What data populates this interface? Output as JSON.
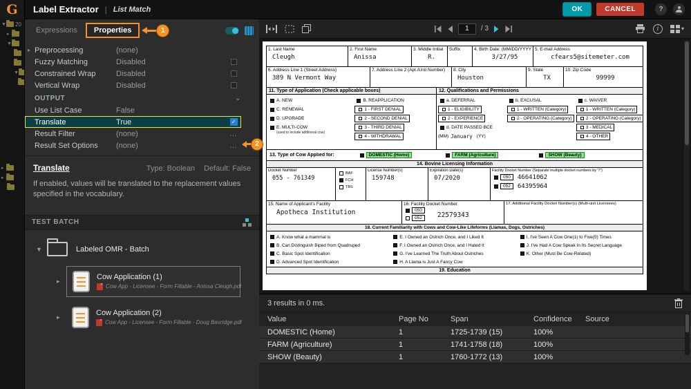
{
  "titlebar": {
    "logo": "G",
    "title": "Label Extractor",
    "separator": "|",
    "subtitle": "List Match",
    "ok_label": "OK",
    "cancel_label": "CANCEL"
  },
  "tree_strip": {
    "root_label": "20"
  },
  "panel": {
    "tabs": {
      "expressions": "Expressions",
      "properties": "Properties"
    },
    "callout1": "1",
    "callout2": "2",
    "rows": [
      {
        "label": "Preprocessing",
        "value": "(none)"
      },
      {
        "label": "Fuzzy Matching",
        "value": "Disabled"
      },
      {
        "label": "Constrained Wrap",
        "value": "Disabled"
      },
      {
        "label": "Vertical Wrap",
        "value": "Disabled"
      }
    ],
    "output_header": "OUTPUT",
    "output_rows": [
      {
        "label": "Use List Case",
        "value": "False"
      },
      {
        "label": "Translate",
        "value": "True"
      },
      {
        "label": "Result Filter",
        "value": "(none)"
      },
      {
        "label": "Result Set Options",
        "value": "(none)"
      }
    ],
    "help": {
      "title": "Translate",
      "type_text": "Type: Boolean",
      "default_text": "Default: False",
      "description": "If enabled, values will be translated to the replacement values specified in the vocabulary."
    },
    "test_batch": {
      "header": "TEST BATCH",
      "folder_label": "Labeled OMR - Batch",
      "docs": [
        {
          "title": "Cow Application (1)",
          "subtitle": "Cow App - Licensee - Form Fillable - Anissa Cleugh.pdf"
        },
        {
          "title": "Cow Application (2)",
          "subtitle": "Cow App - Licensee - Form Fillable - Doug Bavridge.pdf"
        }
      ]
    }
  },
  "viewer": {
    "page_number": "1",
    "page_total": "/ 3"
  },
  "form": {
    "row1": [
      {
        "label": "1. Last Name",
        "value": "Cleugh"
      },
      {
        "label": "2. First Name",
        "value": "Anissa"
      },
      {
        "label": "3. Middle Initial",
        "value": "R."
      },
      {
        "label": "Suffix",
        "value": ""
      },
      {
        "label": "4. Birth Date: (MM/DD/YYYY)",
        "value": "3/27/95"
      },
      {
        "label": "5. E-mail Address",
        "value": "cfears5@sitemeter.com"
      }
    ],
    "row2": [
      {
        "label": "6. Address Line 1 (Street Address)",
        "value": "389 N Vermont Way"
      },
      {
        "label": "7. Address Line 2 (Apt./Unit Number)",
        "value": ""
      },
      {
        "label": "8. City",
        "value": "Houston"
      },
      {
        "label": "9. State",
        "value": "TX"
      },
      {
        "label": "10. Zip Code",
        "value": "99999"
      }
    ],
    "s11": {
      "header": "11. Type of Application (Check applicable boxes)",
      "colA": [
        "A. NEW",
        "C. RENEWAL",
        "D. UPGRADE",
        "E. MULTI-COW"
      ],
      "colA_note": "(used to include additional cow)",
      "colB": [
        "B. REAPPLICATION",
        "1 - FIRST DENIAL",
        "2 - SECOND DENIAL",
        "3 - THIRD DENIAL",
        "4 - WITHDRAWAL"
      ]
    },
    "s12": {
      "header": "12. Qualifications and Permissions",
      "colA": [
        "a. DEFERRAL",
        "1 - ELIGIBILITY",
        "2 - EXPERIENCE",
        "d. DATE PASSED BCE"
      ],
      "mm_label": "(MM)",
      "mm_value": "January",
      "yy_label": "(YY)",
      "colB": [
        "b. EXCUSAL",
        "1 - WRITTEN (Category)",
        "2 - OPERATING (Category)"
      ],
      "colC": [
        "c. WAIVER",
        "1 - WRITTEN (Category)",
        "2 - OPERATING (Category)",
        "3 - MEDICAL",
        "4 - OTHER"
      ]
    },
    "s13": {
      "label": "13. Type of Cow Applied for:",
      "options": [
        "DOMESTIC (Home)",
        "FARM (Agriculture)",
        "SHOW (Beauty)"
      ]
    },
    "s14": {
      "header": "14. Bovine Licensing Information",
      "docket_label": "Docket Number",
      "docket_value": "055 - 761349",
      "checks": [
        "BAF",
        "FCH",
        "TBS"
      ],
      "license_label": "License Number(s)",
      "license_value": "159748",
      "expiration_label": "Expiration Date(s)",
      "expiration_value": "07/2020",
      "facility_label": "Facility Docket Number (Separate multiple docket numbers by \"/\")",
      "facility_rows": [
        {
          "code": "050",
          "value": "46641062"
        },
        {
          "code": "052",
          "value": "64395964"
        }
      ]
    },
    "s15": {
      "label": "15. Name of Applicant's Facility",
      "value": "Apotheca Institution"
    },
    "s16": {
      "label": "16. Facility Docket Number",
      "codes": [
        "050",
        "052"
      ],
      "value": "22579343"
    },
    "s17": {
      "label": "17. Additional Facility Docket Number(s) (Multi-unit Licensees)"
    },
    "s18": {
      "header": "18. Current Familiarity with Cows and Cow-Like Lifeforms (Llamas, Dogs, Ostriches)",
      "col1": [
        "A. Know what a mammal is",
        "B. Can Distinguish Biped from Quadruped",
        "C. Basic Spot Identification",
        "D. Advanced Spot Identification"
      ],
      "col2": [
        "E. I Owned an Ostrich Once, and I Liked It",
        "F. I Owned an Ostrich Once, and I Hated It",
        "G. I've Learned The Truth About Ostriches",
        "H. A Llama is Just A Fancy Cow"
      ],
      "col3": [
        "I. I've Seen A Cow One(1) to Five(5) Times",
        "J. I've Had A Cow Speak In Its Secret Language",
        "K. Other (Must Be Cow-Related)"
      ]
    },
    "s19": {
      "header": "19. Education"
    }
  },
  "results": {
    "summary": "3 results in 0 ms.",
    "columns": [
      "Value",
      "Page No",
      "Span",
      "Confidence",
      "Source"
    ],
    "rows": [
      {
        "value": "DOMESTIC (Home)",
        "page": "1",
        "span": "1725-1739 (15)",
        "confidence": "100%",
        "source": ""
      },
      {
        "value": "FARM (Agriculture)",
        "page": "1",
        "span": "1741-1758 (18)",
        "confidence": "100%",
        "source": ""
      },
      {
        "value": "SHOW (Beauty)",
        "page": "1",
        "span": "1760-1772 (13)",
        "confidence": "100%",
        "source": ""
      }
    ]
  },
  "icons": {
    "expander_collapsed": "▸",
    "expander_expanded": "▼",
    "section_chevron": "⌄",
    "ellipsis": "…",
    "checkmark": "✓",
    "help": "?",
    "caret_down": "▾"
  }
}
